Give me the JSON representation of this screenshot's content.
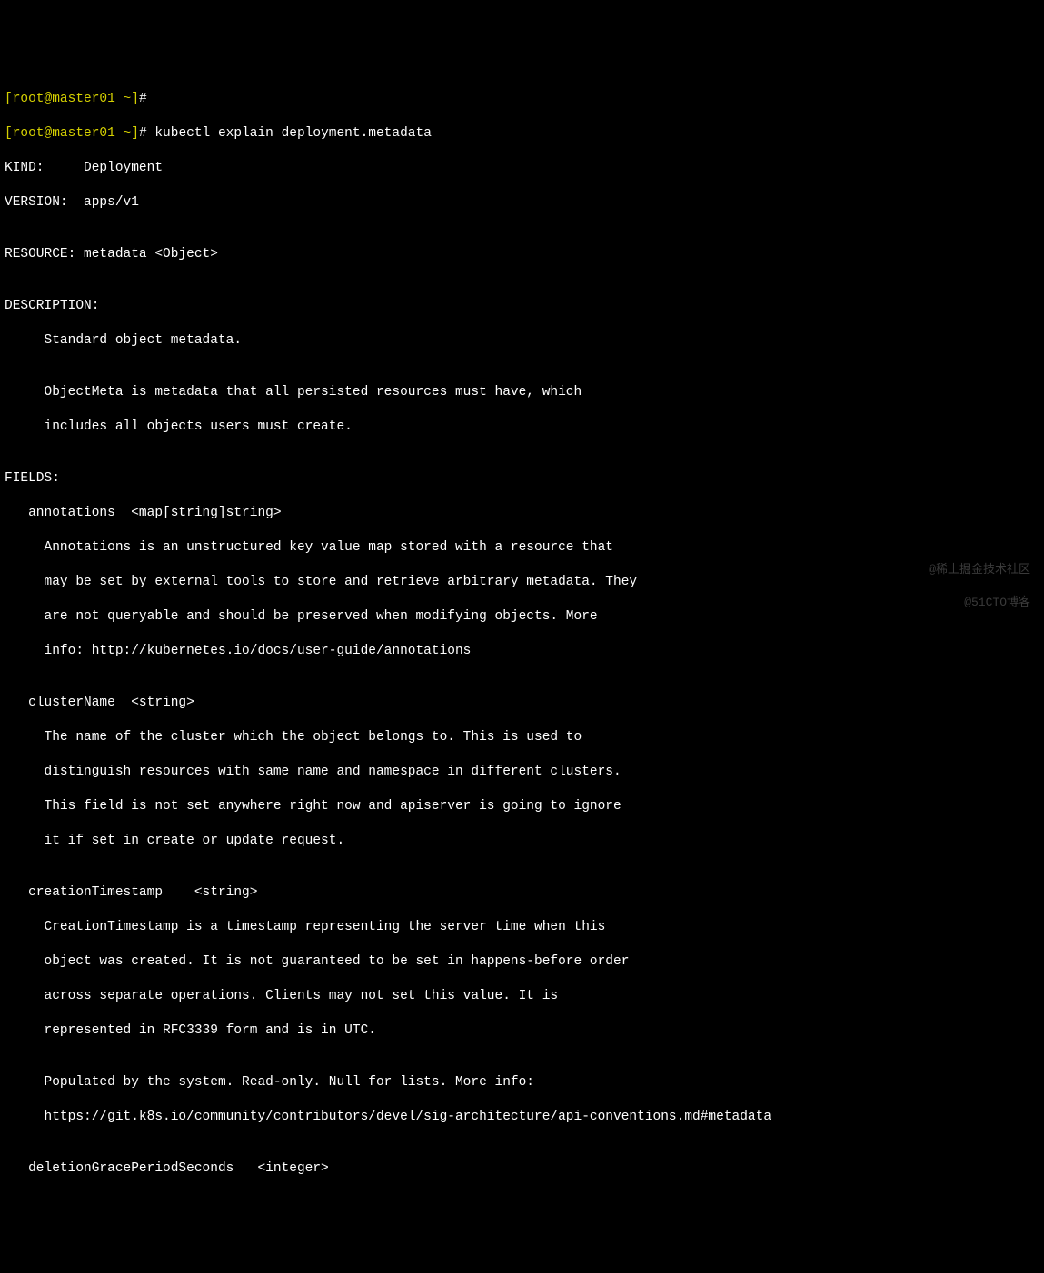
{
  "prompt1": {
    "bracket": "[root@master01 ~]",
    "hash": "#"
  },
  "prompt2": {
    "bracket": "[root@master01 ~]",
    "hash": "#",
    "command": " kubectl explain deployment.metadata"
  },
  "output": {
    "kind": "KIND:     Deployment",
    "version": "VERSION:  apps/v1",
    "blank1": "",
    "resource": "RESOURCE: metadata <Object>",
    "blank2": "",
    "descHeader": "DESCRIPTION:",
    "desc1": "     Standard object metadata.",
    "blank3": "",
    "desc2": "     ObjectMeta is metadata that all persisted resources must have, which",
    "desc3": "     includes all objects users must create.",
    "blank4": "",
    "fieldsHeader": "FIELDS:",
    "annot1": "   annotations  <map[string]string>",
    "annot2": "     Annotations is an unstructured key value map stored with a resource that",
    "annot3": "     may be set by external tools to store and retrieve arbitrary metadata. They",
    "annot4": "     are not queryable and should be preserved when modifying objects. More",
    "annot5": "     info: http://kubernetes.io/docs/user-guide/annotations",
    "blank5": "",
    "cluster1": "   clusterName  <string>",
    "cluster2": "     The name of the cluster which the object belongs to. This is used to",
    "cluster3": "     distinguish resources with same name and namespace in different clusters.",
    "cluster4": "     This field is not set anywhere right now and apiserver is going to ignore",
    "cluster5": "     it if set in create or update request.",
    "blank6": "",
    "ctime1": "   creationTimestamp    <string>",
    "ctime2": "     CreationTimestamp is a timestamp representing the server time when this",
    "ctime3": "     object was created. It is not guaranteed to be set in happens-before order",
    "ctime4": "     across separate operations. Clients may not set this value. It is",
    "ctime5": "     represented in RFC3339 form and is in UTC.",
    "blank7": "",
    "ctime6": "     Populated by the system. Read-only. Null for lists. More info:",
    "ctime7": "     https://git.k8s.io/community/contributors/devel/sig-architecture/api-conventions.md#metadata",
    "blank8": "",
    "dgrace": "   deletionGracePeriodSeconds   <integer>"
  },
  "watermark": {
    "line1": "@稀土掘金技术社区",
    "line2": "@51CTO博客"
  }
}
